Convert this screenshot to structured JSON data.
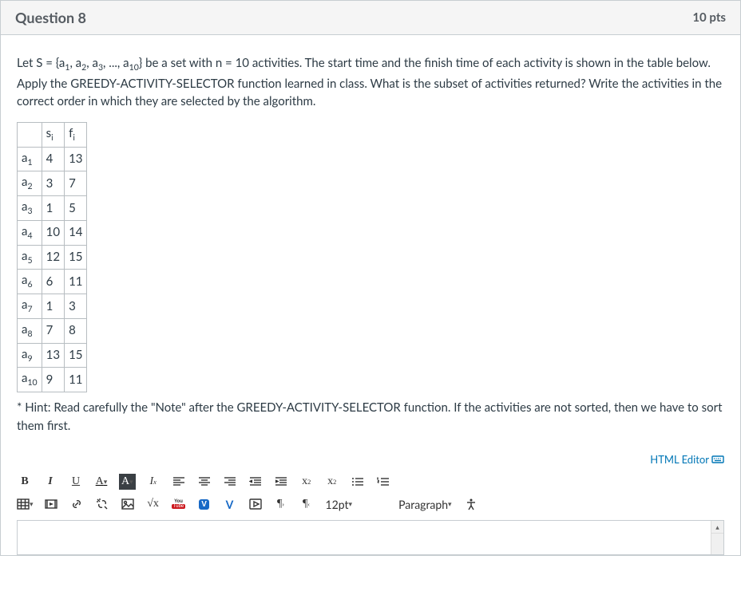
{
  "header": {
    "title": "Question 8",
    "points": "10 pts"
  },
  "question": {
    "para1_pre": "Let S = {a",
    "para1_s1": "1",
    "para1_mid1": ", a",
    "para1_s2": "2",
    "para1_mid2": ", a",
    "para1_s3": "3",
    "para1_mid3": ", ..., a",
    "para1_s4": "10",
    "para1_post": "} be a set with n = 10 activities. The start time and the finish time of each activity is shown in the table below. Apply the GREEDY-ACTIVITY-SELECTOR function learned in class. What is the subset of activities returned? Write the activities in the correct order in which they are selected by the algorithm.",
    "col_s_base": "s",
    "col_s_sub": "i",
    "col_f_base": "f",
    "col_f_sub": "i",
    "row_label_base": "a",
    "hint": "* Hint: Read carefully the \"Note\" after the GREEDY-ACTIVITY-SELECTOR function. If the activities are not sorted, then we have to sort them first."
  },
  "chart_data": {
    "type": "table",
    "columns": [
      "activity",
      "s_i",
      "f_i"
    ],
    "rows": [
      {
        "activity": "a1",
        "sub": "1",
        "s": "4",
        "f": "13"
      },
      {
        "activity": "a2",
        "sub": "2",
        "s": "3",
        "f": "7"
      },
      {
        "activity": "a3",
        "sub": "3",
        "s": "1",
        "f": "5"
      },
      {
        "activity": "a4",
        "sub": "4",
        "s": "10",
        "f": "14"
      },
      {
        "activity": "a5",
        "sub": "5",
        "s": "12",
        "f": "15"
      },
      {
        "activity": "a6",
        "sub": "6",
        "s": "6",
        "f": "11"
      },
      {
        "activity": "a7",
        "sub": "7",
        "s": "1",
        "f": "3"
      },
      {
        "activity": "a8",
        "sub": "8",
        "s": "7",
        "f": "8"
      },
      {
        "activity": "a9",
        "sub": "9",
        "s": "13",
        "f": "15"
      },
      {
        "activity": "a10",
        "sub": "10",
        "s": "9",
        "f": "11"
      }
    ]
  },
  "editor": {
    "html_editor_label": "HTML Editor",
    "font_size": "12pt",
    "block_format": "Paragraph"
  }
}
